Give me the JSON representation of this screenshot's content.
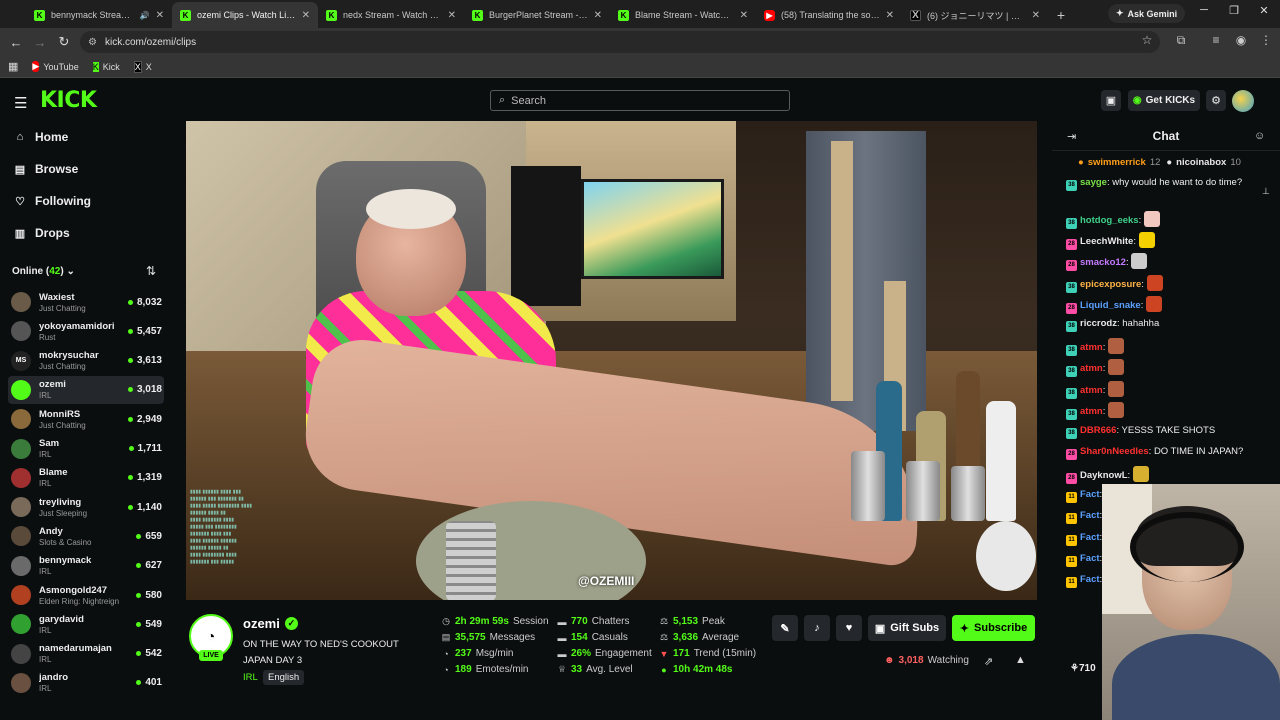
{
  "browser": {
    "tabs": [
      {
        "title": "bennymack Stream - W",
        "favicon": "kick",
        "has_audio": true
      },
      {
        "title": "ozemi Clips - Watch Live on",
        "favicon": "kick",
        "active": true
      },
      {
        "title": "nedx Stream - Watch Live o",
        "favicon": "kick"
      },
      {
        "title": "BurgerPlanet Stream - Watc",
        "favicon": "kick"
      },
      {
        "title": "Blame Stream - Watch Live",
        "favicon": "kick"
      },
      {
        "title": "(58) Translating the song's r",
        "favicon": "youtube"
      },
      {
        "title": "(6) ジョニーリマツ | 遊器外国人",
        "favicon": "x"
      }
    ],
    "ask_gemini": "Ask Gemini",
    "url": "kick.com/ozemi/clips",
    "bookmarks": [
      {
        "label": "YouTube",
        "favicon": "youtube"
      },
      {
        "label": "Kick",
        "favicon": "kick"
      },
      {
        "label": "X",
        "favicon": "x"
      }
    ]
  },
  "header": {
    "logo": "KICK",
    "search_placeholder": "Search",
    "get_kicks": "Get KICKs",
    "accent": "#53fc18"
  },
  "sidebar": {
    "nav": [
      {
        "label": "Home",
        "icon": "home-icon"
      },
      {
        "label": "Browse",
        "icon": "browse-icon"
      },
      {
        "label": "Following",
        "icon": "heart-icon"
      },
      {
        "label": "Drops",
        "icon": "drops-icon"
      }
    ],
    "online_label": "Online",
    "online_count": "42",
    "channels": [
      {
        "name": "Waxiest",
        "category": "Just Chatting",
        "viewers": "8,032",
        "avatar_color": "#6a5a48"
      },
      {
        "name": "yokoyamamidori",
        "category": "Rust",
        "viewers": "5,457",
        "avatar_color": "#555"
      },
      {
        "name": "mokrysuchar",
        "category": "Just Chatting",
        "viewers": "3,613",
        "avatar_color": "#222",
        "initials": "MS"
      },
      {
        "name": "ozemi",
        "category": "IRL",
        "viewers": "3,018",
        "avatar_color": "#53fc18",
        "selected": true
      },
      {
        "name": "MonniRS",
        "category": "Just Chatting",
        "viewers": "2,949",
        "avatar_color": "#8a6a3a"
      },
      {
        "name": "Sam",
        "category": "IRL",
        "viewers": "1,711",
        "avatar_color": "#3a7a3a"
      },
      {
        "name": "Blame",
        "category": "IRL",
        "viewers": "1,319",
        "avatar_color": "#a03030"
      },
      {
        "name": "treyliving",
        "category": "Just Sleeping",
        "viewers": "1,140",
        "avatar_color": "#7a6a5a"
      },
      {
        "name": "Andy",
        "category": "Slots & Casino",
        "viewers": "659",
        "avatar_color": "#5a4a3a"
      },
      {
        "name": "bennymack",
        "category": "IRL",
        "viewers": "627",
        "avatar_color": "#6a6a6a"
      },
      {
        "name": "Asmongold247",
        "category": "Elden Ring: Nightreign",
        "viewers": "580",
        "avatar_color": "#b04020"
      },
      {
        "name": "garydavid",
        "category": "IRL",
        "viewers": "549",
        "avatar_color": "#30a030"
      },
      {
        "name": "namedarumajan",
        "category": "IRL",
        "viewers": "542",
        "avatar_color": "#444"
      },
      {
        "name": "jandro",
        "category": "IRL",
        "viewers": "401",
        "avatar_color": "#6a5040"
      }
    ]
  },
  "video": {
    "watermark": "@OZEMIII"
  },
  "stream": {
    "channel": "ozemi",
    "live_badge": "LIVE",
    "title": "ON THE WAY TO NED'S COOKOUT JAPAN DAY 3",
    "category": "IRL",
    "language": "English",
    "stats": [
      {
        "value": "2h 29m 59s",
        "label": "Session",
        "icon": "clock-icon"
      },
      {
        "value": "35,575",
        "label": "Messages",
        "icon": "message-icon"
      },
      {
        "value": "237",
        "label": "Msg/min",
        "icon": "speed-icon"
      },
      {
        "value": "189",
        "label": "Emotes/min",
        "icon": "speed-icon"
      },
      {
        "value": "770",
        "label": "Chatters",
        "icon": "list-icon"
      },
      {
        "value": "154",
        "label": "Casuals",
        "icon": "list-icon"
      },
      {
        "value": "26%",
        "label": "Engagement",
        "icon": "list-icon"
      },
      {
        "value": "33",
        "label": "Avg. Level",
        "icon": "trophy-icon"
      },
      {
        "value": "5,153",
        "label": "Peak",
        "icon": "scale-icon"
      },
      {
        "value": "3,636",
        "label": "Average",
        "icon": "scale-icon"
      },
      {
        "value": "171",
        "label": "Trend (15min)",
        "icon": "trend-down-icon"
      },
      {
        "value": "10h 42m 48s",
        "label": "",
        "icon": "dot-icon"
      }
    ],
    "gift_subs": "Gift Subs",
    "subscribe": "Subscribe",
    "watching_count": "3,018",
    "watching_label": "Watching"
  },
  "chat": {
    "title": "Chat",
    "pinned": [
      {
        "user": "swimmerrick",
        "count": "12",
        "color": "#ff9f1a"
      },
      {
        "user": "nicoinabox",
        "count": "10",
        "color": "#e8e8e8"
      }
    ],
    "messages": [
      {
        "user": "sayge",
        "color": "#7ae04a",
        "text": "why would he want to do time?",
        "badge": "sub"
      },
      {
        "user": "hotdog_eeks",
        "color": "#3fd08a",
        "text": "",
        "badge": "sub",
        "emote": "#f0c8c0"
      },
      {
        "user": "LeechWhite",
        "color": "#e8e8e8",
        "text": "",
        "badge": "gift",
        "emote": "#f5d000"
      },
      {
        "user": "smacko12",
        "color": "#c47aff",
        "text": "",
        "badge": "gift",
        "emote": "#cccccc"
      },
      {
        "user": "epicexposure",
        "color": "#ffb347",
        "text": "",
        "badge": "sub",
        "emote": "#cc4422"
      },
      {
        "user": "Liquid_snake",
        "color": "#5aa0ff",
        "text": "",
        "badge": "gift",
        "emote": "#cc4422"
      },
      {
        "user": "riccrodz",
        "color": "#e8e8e8",
        "text": "hahahha",
        "badge": "sub"
      },
      {
        "user": "atmn",
        "color": "#ff3030",
        "text": "",
        "badge": "sub",
        "emote": "#b06040"
      },
      {
        "user": "atmn",
        "color": "#ff3030",
        "text": "",
        "badge": "sub",
        "emote": "#b06040"
      },
      {
        "user": "atmn",
        "color": "#ff3030",
        "text": "",
        "badge": "sub",
        "emote": "#b06040"
      },
      {
        "user": "atmn",
        "color": "#ff3030",
        "text": "",
        "badge": "sub",
        "emote": "#b06040"
      },
      {
        "user": "DBR666",
        "color": "#ff3030",
        "text": "YESSS TAKE SHOTS",
        "badge": "sub"
      },
      {
        "user": "Shar0nNeedles",
        "color": "#ff3030",
        "text": "DO TIME IN JAPAN?",
        "badge": "gift"
      },
      {
        "user": "DayknowL",
        "color": "#e8e8e8",
        "text": "",
        "badge": "gift",
        "emote": "#d8b030"
      },
      {
        "user": "Fact",
        "color": "#5aa0ff",
        "text": "",
        "badge": "og"
      },
      {
        "user": "Fact",
        "color": "#5aa0ff",
        "text": "",
        "badge": "og"
      },
      {
        "user": "Fact",
        "color": "#5aa0ff",
        "text": "",
        "badge": "og"
      },
      {
        "user": "Fact",
        "color": "#5aa0ff",
        "text": "",
        "badge": "og"
      },
      {
        "user": "Fact",
        "color": "#5aa0ff",
        "text": "",
        "badge": "og"
      }
    ],
    "bottom_count": "710"
  }
}
